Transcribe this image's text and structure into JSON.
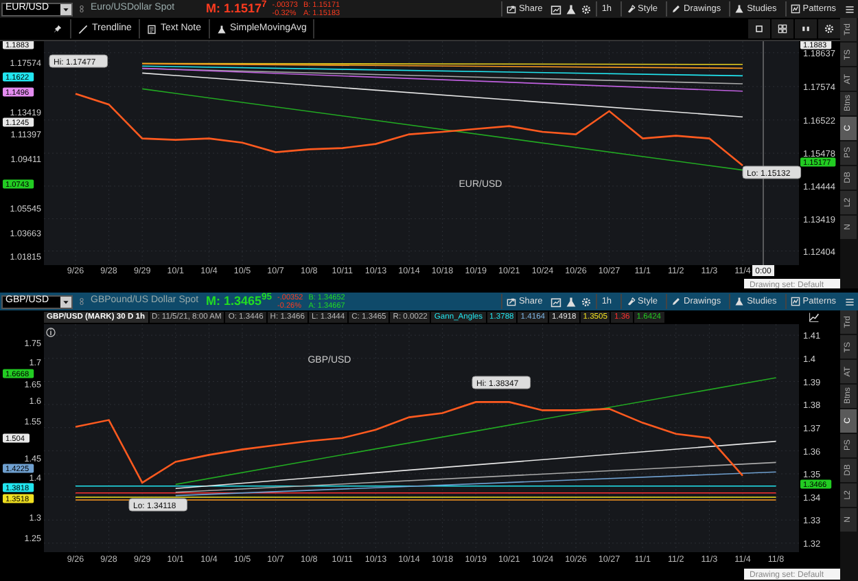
{
  "panels": [
    {
      "symbol": "EUR/USD",
      "description": "Euro/USDollar Spot",
      "mark": "M: 1.1517$^{7}$",
      "price_up": false,
      "change": "-.00373",
      "change_pct": "-0.32%",
      "bid": "B: 1.15171",
      "ask": "A: 1.15183",
      "active": false,
      "toolbar": [
        "Share",
        "1h",
        "Style",
        "Drawings",
        "Studies",
        "Patterns"
      ],
      "drawing_tools": [
        "Trendline",
        "Text Note",
        "SimpleMovingAvg"
      ],
      "chart": {
        "hi": "Hi: 1.17477",
        "lo": "Lo: 1.15132",
        "time_label": "0:00",
        "drawing_set": "Drawing set: Default",
        "left_axis": [
          "1.17574",
          "1.13419",
          "1.11397",
          "1.09411",
          "1.05545",
          "1.03663",
          "1.01815"
        ],
        "left_badges": [
          {
            "text": "1.1883",
            "color": "#e8e8e8"
          },
          {
            "text": "1.1622",
            "color": "#22e6f0"
          },
          {
            "text": "1.1496",
            "color": "#e48cf0"
          },
          {
            "text": "1.1245",
            "color": "#e8e8e8"
          },
          {
            "text": "1.0743",
            "color": "#22cc22"
          }
        ],
        "right_badges": [
          {
            "text": "1.1883",
            "color": "#e8e8e8"
          },
          {
            "text": "1.15177",
            "color": "#22cc22"
          }
        ],
        "chart_data": {
          "type": "line",
          "categories": [
            "9/26",
            "9/28",
            "9/29",
            "10/1",
            "10/4",
            "10/5",
            "10/7",
            "10/8",
            "10/11",
            "10/13",
            "10/14",
            "10/18",
            "10/19",
            "10/21",
            "10/24",
            "10/26",
            "10/27",
            "11/1",
            "11/2",
            "11/3",
            "11/4"
          ],
          "series": [
            {
              "name": "EUR/USD",
              "color": "#ff5a1f",
              "values": [
                1.1735,
                1.1701,
                1.1594,
                1.159,
                1.1594,
                1.1581,
                1.1551,
                1.156,
                1.1564,
                1.1577,
                1.1607,
                1.1615,
                1.1624,
                1.1633,
                1.1615,
                1.1607,
                1.168,
                1.1594,
                1.1603,
                1.1594,
                1.1509
              ]
            },
            {
              "color": "#ff9a20",
              "values": [
                null,
                null,
                1.1829,
                null,
                null,
                null,
                null,
                null,
                null,
                null,
                null,
                null,
                null,
                null,
                null,
                null,
                null,
                null,
                null,
                null,
                1.1815
              ]
            },
            {
              "color": "#e8d020",
              "values": [
                null,
                null,
                1.183,
                null,
                null,
                null,
                null,
                null,
                null,
                null,
                null,
                null,
                null,
                null,
                null,
                null,
                null,
                null,
                null,
                null,
                1.1827
              ]
            },
            {
              "color": "#22e6f0",
              "values": [
                null,
                null,
                1.1822,
                null,
                null,
                null,
                null,
                null,
                null,
                null,
                null,
                null,
                null,
                null,
                null,
                null,
                null,
                null,
                null,
                null,
                1.1791
              ]
            },
            {
              "color": "#c060e0",
              "values": [
                null,
                null,
                1.1815,
                null,
                null,
                null,
                null,
                null,
                null,
                null,
                null,
                null,
                null,
                null,
                null,
                null,
                null,
                null,
                null,
                null,
                1.1743
              ]
            },
            {
              "color": "#e8e8e8",
              "values": [
                null,
                null,
                1.18,
                null,
                null,
                null,
                null,
                null,
                null,
                null,
                null,
                null,
                null,
                null,
                null,
                null,
                null,
                null,
                null,
                null,
                1.1662
              ]
            },
            {
              "color": "#aaaaaa",
              "values": [
                null,
                null,
                1.1814,
                null,
                null,
                null,
                null,
                null,
                null,
                null,
                null,
                null,
                null,
                null,
                null,
                null,
                null,
                null,
                null,
                null,
                1.1766
              ]
            },
            {
              "color": "#22aa22",
              "values": [
                null,
                null,
                1.175,
                null,
                null,
                null,
                null,
                null,
                null,
                null,
                null,
                null,
                null,
                null,
                null,
                null,
                null,
                null,
                null,
                null,
                1.1495
              ]
            }
          ],
          "ylim": [
            1.1196,
            1.19
          ],
          "grid": true,
          "yticks": [
            1.18637,
            1.17574,
            1.16522,
            1.15478,
            1.14444,
            1.13419,
            1.12404
          ]
        }
      },
      "side_tabs": [
        {
          "label": "Trd",
          "selected": false
        },
        {
          "label": "TS",
          "selected": false
        },
        {
          "label": "AT",
          "selected": false
        },
        {
          "label": "Btns",
          "selected": false
        },
        {
          "label": "C",
          "selected": true
        },
        {
          "label": "PS",
          "selected": false
        },
        {
          "label": "DB",
          "selected": false
        },
        {
          "label": "L2",
          "selected": false
        },
        {
          "label": "N",
          "selected": false
        }
      ]
    },
    {
      "symbol": "GBP/USD",
      "description": "GBPound/US Dollar Spot",
      "mark": "M: 1.3465$^{95}$",
      "price_up": true,
      "change": "-.00352",
      "change_pct": "-0.26%",
      "bid": "B: 1.34652",
      "ask": "A: 1.34667",
      "active": true,
      "toolbar": [
        "Share",
        "1h",
        "Style",
        "Drawings",
        "Studies",
        "Patterns"
      ],
      "info": {
        "title": "GBP/USD (MARK) 30 D 1h",
        "fields": [
          "D: 11/5/21, 8:00 AM",
          "O: 1.3446",
          "H: 1.3466",
          "L: 1.3444",
          "C: 1.3465",
          "R: 0.0022"
        ],
        "study": "Gann_Angles",
        "study_values": [
          {
            "text": "1.3788",
            "color": "#22e6f0"
          },
          {
            "text": "1.4164",
            "color": "#7fb8e8"
          },
          {
            "text": "1.4918",
            "color": "#e8e8e8"
          },
          {
            "text": "1.3505",
            "color": "#f0e020"
          },
          {
            "text": "1.36",
            "color": "#ff3030"
          },
          {
            "text": "1.6424",
            "color": "#22cc22"
          }
        ]
      },
      "chart": {
        "hi": "Hi: 1.38347",
        "lo": "Lo: 1.34118",
        "drawing_set": "Drawing set: Default",
        "left_axis": [
          "1.75",
          "1.7",
          "1.65",
          "1.6",
          "1.55",
          "1.45",
          "1.4",
          "1.3",
          "1.25"
        ],
        "left_badges": [
          {
            "text": "1.6668",
            "color": "#22cc22"
          },
          {
            "text": "1.504",
            "color": "#e8e8e8"
          },
          {
            "text": "1.4225",
            "color": "#6fa0d0"
          },
          {
            "text": "1.3818",
            "color": "#22e6f0"
          },
          {
            "text": "1.3518",
            "color": "#f0e020"
          }
        ],
        "right_badges": [
          {
            "text": "1.3466",
            "color": "#22cc22"
          }
        ],
        "chart_data": {
          "type": "line",
          "categories": [
            "9/26",
            "9/28",
            "9/29",
            "10/1",
            "10/4",
            "10/5",
            "10/7",
            "10/8",
            "10/11",
            "10/13",
            "10/14",
            "10/18",
            "10/19",
            "10/21",
            "10/24",
            "10/26",
            "10/27",
            "11/1",
            "11/2",
            "11/3",
            "11/4",
            "11/8"
          ],
          "series": [
            {
              "name": "GBP/USD",
              "color": "#ff5a1f",
              "values": [
                1.3703,
                1.3733,
                1.3462,
                1.3552,
                1.3582,
                1.3606,
                1.3624,
                1.3642,
                1.3655,
                1.3691,
                1.3745,
                1.3763,
                1.3811,
                1.3811,
                1.3775,
                1.3775,
                1.3781,
                1.3721,
                1.3673,
                1.3655,
                1.3492,
                null
              ]
            },
            {
              "color": "#22aa22",
              "values": [
                null,
                null,
                null,
                1.3454,
                null,
                null,
                null,
                null,
                null,
                null,
                null,
                null,
                null,
                null,
                null,
                null,
                null,
                null,
                null,
                null,
                null,
                1.3916
              ]
            },
            {
              "color": "#e8e8e8",
              "values": [
                null,
                null,
                null,
                1.3437,
                null,
                null,
                null,
                null,
                null,
                null,
                null,
                null,
                null,
                null,
                null,
                null,
                null,
                null,
                null,
                null,
                null,
                1.3641
              ]
            },
            {
              "color": "#aaaaaa",
              "values": [
                null,
                null,
                null,
                1.342,
                null,
                null,
                null,
                null,
                null,
                null,
                null,
                null,
                null,
                null,
                null,
                null,
                null,
                null,
                null,
                null,
                null,
                1.3549
              ]
            },
            {
              "color": "#6fa0d0",
              "values": [
                null,
                null,
                null,
                1.3406,
                null,
                null,
                null,
                null,
                null,
                null,
                null,
                null,
                null,
                null,
                null,
                null,
                null,
                null,
                null,
                null,
                null,
                1.3508
              ]
            },
            {
              "color": "#22e6f0",
              "values": [
                1.3447,
                null,
                null,
                null,
                null,
                null,
                null,
                null,
                null,
                null,
                null,
                null,
                null,
                null,
                null,
                null,
                null,
                null,
                null,
                null,
                null,
                1.3447
              ]
            },
            {
              "color": "#ff3030",
              "values": [
                1.3417,
                null,
                null,
                null,
                null,
                null,
                null,
                null,
                null,
                null,
                null,
                null,
                null,
                null,
                null,
                null,
                null,
                null,
                null,
                null,
                null,
                1.3417
              ]
            },
            {
              "color": "#f0e020",
              "values": [
                1.3399,
                null,
                null,
                null,
                null,
                null,
                null,
                null,
                null,
                null,
                null,
                null,
                null,
                null,
                null,
                null,
                null,
                null,
                null,
                null,
                null,
                1.3399
              ]
            },
            {
              "color": "#ff9a20",
              "values": [
                1.3387,
                null,
                null,
                null,
                null,
                null,
                null,
                null,
                null,
                null,
                null,
                null,
                null,
                null,
                null,
                null,
                null,
                null,
                null,
                null,
                null,
                1.3387
              ]
            }
          ],
          "ylim": [
            1.3161,
            1.4148
          ],
          "grid": true,
          "yticks": [
            1.41,
            1.4,
            1.39,
            1.38,
            1.37,
            1.36,
            1.35,
            1.34,
            1.33,
            1.32
          ]
        }
      },
      "side_tabs": [
        {
          "label": "Trd",
          "selected": false
        },
        {
          "label": "TS",
          "selected": false
        },
        {
          "label": "AT",
          "selected": false
        },
        {
          "label": "Btns",
          "selected": false
        },
        {
          "label": "C",
          "selected": true
        },
        {
          "label": "PS",
          "selected": false
        },
        {
          "label": "DB",
          "selected": false
        },
        {
          "label": "L2",
          "selected": false
        },
        {
          "label": "N",
          "selected": false
        }
      ]
    }
  ]
}
